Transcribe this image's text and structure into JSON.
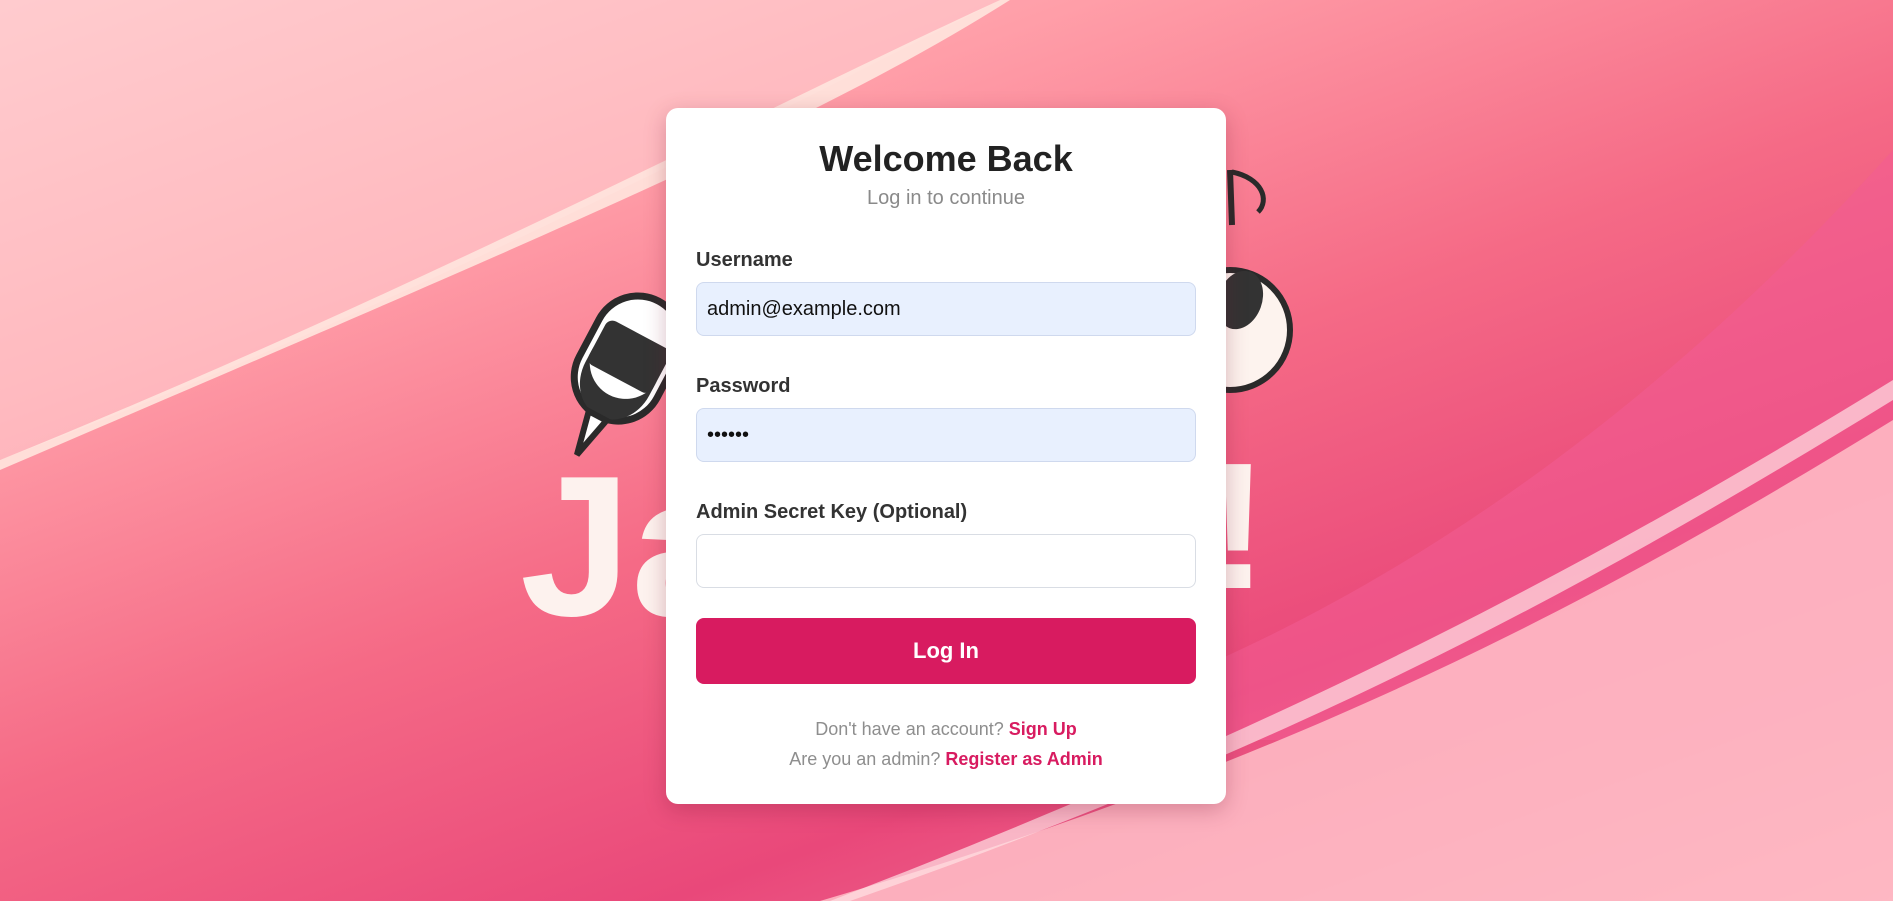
{
  "form": {
    "title": "Welcome Back",
    "subtitle": "Log in to continue",
    "username_label": "Username",
    "username_value": "admin@example.com",
    "password_label": "Password",
    "password_value": "123456",
    "admin_key_label": "Admin Secret Key (Optional)",
    "admin_key_value": "",
    "submit_label": "Log In",
    "signup_prompt": "Don't have an account?",
    "signup_link": "Sign Up",
    "admin_prompt": "Are you an admin?",
    "admin_link": "Register as Admin"
  },
  "background": {
    "logo_letters_left": "Ja",
    "logo_letters_right": "!"
  },
  "colors": {
    "accent": "#d81b60",
    "autofill": "#e8f0fe"
  },
  "icons": [
    "microphone-icon",
    "music-note-icon"
  ]
}
